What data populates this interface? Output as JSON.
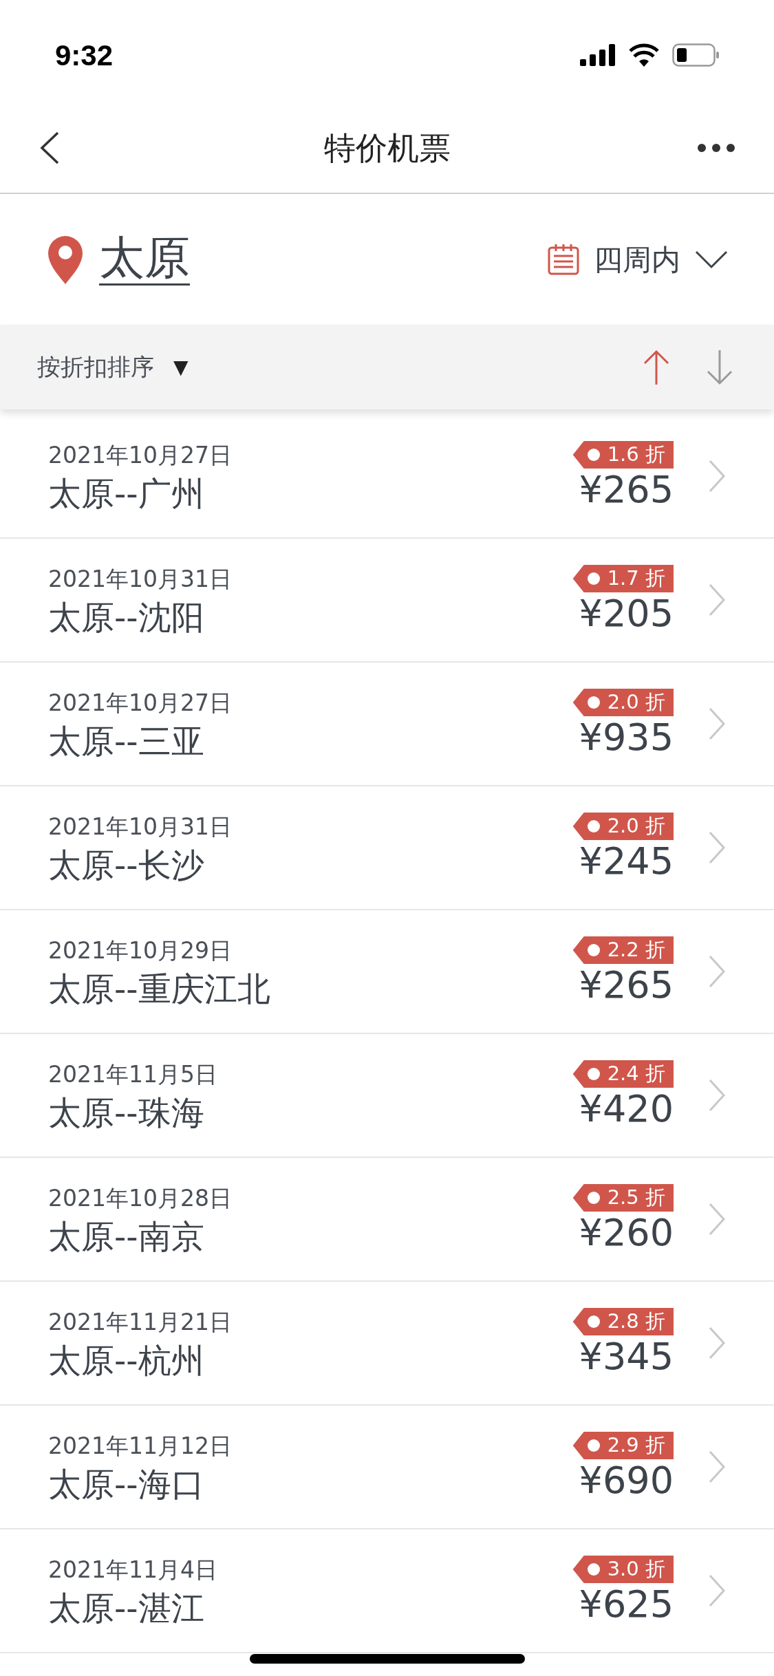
{
  "status_bar": {
    "time": "9:32"
  },
  "nav": {
    "title": "特价机票"
  },
  "location": {
    "city": "太原",
    "period": "四周内"
  },
  "sort": {
    "label": "按折扣排序",
    "caret": "▼",
    "directions": [
      {
        "kind": "up",
        "selected": true
      },
      {
        "kind": "down",
        "selected": false
      }
    ]
  },
  "flights": [
    {
      "date": "2021年10月27日",
      "route": "太原--广州",
      "discount": "1.6 折",
      "price": "¥265"
    },
    {
      "date": "2021年10月31日",
      "route": "太原--沈阳",
      "discount": "1.7 折",
      "price": "¥205"
    },
    {
      "date": "2021年10月27日",
      "route": "太原--三亚",
      "discount": "2.0 折",
      "price": "¥935"
    },
    {
      "date": "2021年10月31日",
      "route": "太原--长沙",
      "discount": "2.0 折",
      "price": "¥245"
    },
    {
      "date": "2021年10月29日",
      "route": "太原--重庆江北",
      "discount": "2.2 折",
      "price": "¥265"
    },
    {
      "date": "2021年11月5日",
      "route": "太原--珠海",
      "discount": "2.4 折",
      "price": "¥420"
    },
    {
      "date": "2021年10月28日",
      "route": "太原--南京",
      "discount": "2.5 折",
      "price": "¥260"
    },
    {
      "date": "2021年11月21日",
      "route": "太原--杭州",
      "discount": "2.8 折",
      "price": "¥345"
    },
    {
      "date": "2021年11月12日",
      "route": "太原--海口",
      "discount": "2.9 折",
      "price": "¥690"
    },
    {
      "date": "2021年11月4日",
      "route": "太原--湛江",
      "discount": "3.0 折",
      "price": "¥625"
    }
  ]
}
